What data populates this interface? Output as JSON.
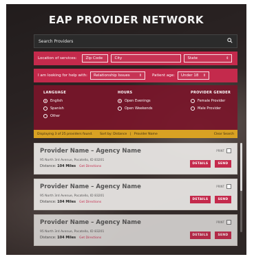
{
  "header": {
    "title": "EAP PROVIDER NETWORK"
  },
  "search": {
    "placeholder": "Search Providers",
    "icon": "search-icon"
  },
  "location_bar": {
    "label": "Location of services:",
    "zip": "Zip Code",
    "city": "City",
    "state": "State"
  },
  "help_bar": {
    "label": "I am looking for help with:",
    "topic": "Relationship Issues",
    "age_label": "Patient age:",
    "age": "Under 18"
  },
  "filters": {
    "language": {
      "heading": "LANGUAGE",
      "options": [
        "English",
        "Spanish",
        "Other"
      ],
      "selected": "English"
    },
    "hours": {
      "heading": "HOURS",
      "options": [
        "Open Evenings",
        "Open Weekends"
      ],
      "selected": "Open Evenings"
    },
    "gender": {
      "heading": "PROVIDER GENDER",
      "options": [
        "Female Provider",
        "Male Provider"
      ],
      "selected": ""
    }
  },
  "status": {
    "results": "Displaying 3 of 25 providers found.",
    "sort_by": "Sort by: Distance",
    "provider_name": "Provider Name",
    "clear": "Clear Search"
  },
  "providers": [
    {
      "name": "Provider Name – Agency Name",
      "address": "95 North 3rd Avenue, Pocatello, ID 83201",
      "distance_label": "Distance:",
      "distance": "104 Miles",
      "directions": "Get Directions",
      "print": "PRINT",
      "details": "DETAILS",
      "send": "SEND"
    },
    {
      "name": "Provider Name – Agency Name",
      "address": "95 North 3rd Avenue, Pocatello, ID 83201",
      "distance_label": "Distance:",
      "distance": "104 Miles",
      "directions": "Get Directions",
      "print": "PRINT",
      "details": "DETAILS",
      "send": "SEND"
    },
    {
      "name": "Provider Name – Agency Name",
      "address": "95 North 3rd Avenue, Pocatello, ID 83201",
      "distance_label": "Distance:",
      "distance": "104 Miles",
      "directions": "Get Directions",
      "print": "PRINT",
      "details": "DETAILS",
      "send": "SEND"
    }
  ],
  "colors": {
    "accent": "#c42a4c",
    "filter_panel": "#78162a",
    "status_bar": "#d9a223"
  }
}
